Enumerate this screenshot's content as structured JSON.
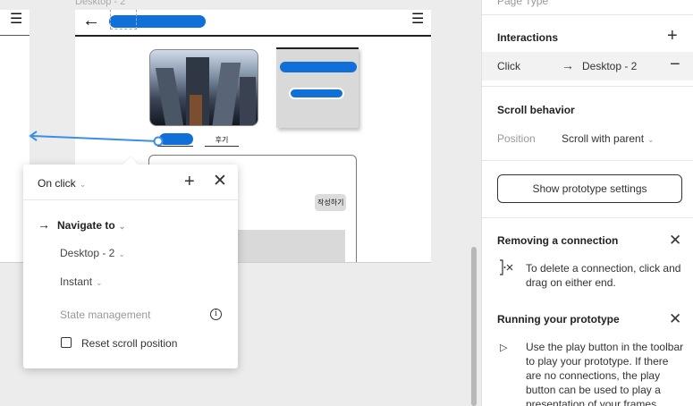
{
  "canvas": {
    "frame_label": "Desktop - 2",
    "review_label": "후기",
    "write_button": "작성하기"
  },
  "popover": {
    "trigger": "On click",
    "action": "Navigate to",
    "destination": "Desktop - 2",
    "animation": "Instant",
    "state_heading": "State management",
    "reset_scroll_label": "Reset scroll position",
    "reset_scroll_checked": false
  },
  "sidebar": {
    "top_fragment": "Page  Type",
    "interactions_title": "Interactions",
    "interaction": {
      "trigger": "Click",
      "destination": "Desktop - 2"
    },
    "scroll_title": "Scroll behavior",
    "position_label": "Position",
    "position_value": "Scroll with parent",
    "prototype_settings_button": "Show prototype settings",
    "tips": [
      {
        "title": "Removing a connection",
        "body": "To delete a connection, click and drag on either end."
      },
      {
        "title": "Running your prototype",
        "body": "Use the play button in the toolbar to play your prototype. If there are no connections, the play button can be used to play a presentation of your frames."
      }
    ]
  },
  "colors": {
    "accent": "#1170d8",
    "connector": "#3b8ee8",
    "placeholder_grey": "#d9d9d9"
  },
  "icons": [
    "hamburger-icon",
    "back-arrow-icon",
    "plus-icon",
    "close-icon",
    "chevron-down-icon",
    "arrow-right-icon",
    "info-icon",
    "minus-icon",
    "connection-delete-icon",
    "play-icon"
  ]
}
